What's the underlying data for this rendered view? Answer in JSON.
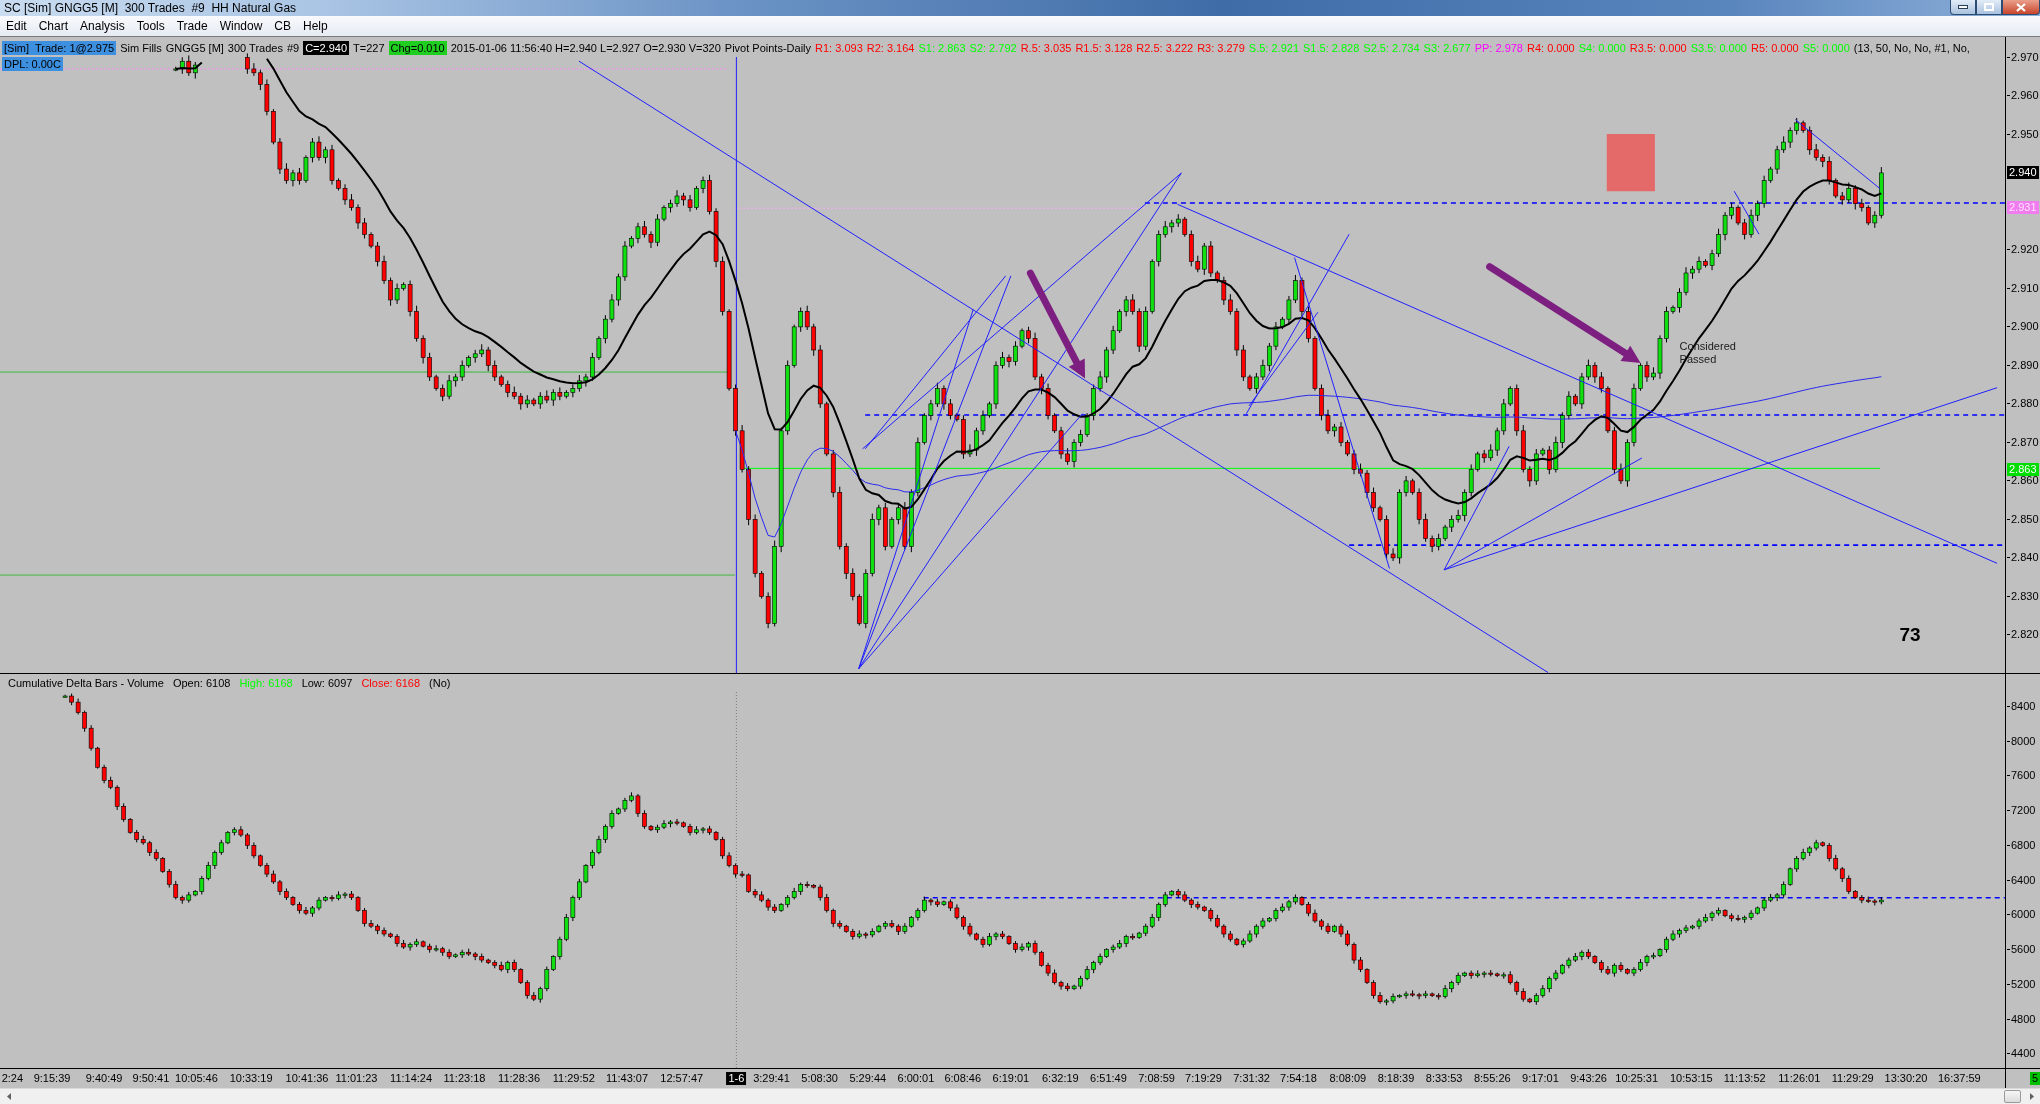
{
  "window": {
    "title": "SC [Sim] GNGG5 [M]  300 Trades  #9  HH Natural Gas"
  },
  "menu": [
    "Edit",
    "Chart",
    "Analysis",
    "Tools",
    "Trade",
    "Window",
    "CB",
    "Help"
  ],
  "price_panel": {
    "legend_rows": [
      [
        {
          "text": "[Sim]  Trade: 1@2.975",
          "kind": "highlight"
        },
        {
          "text": "Sim Fills",
          "kind": "plain"
        },
        {
          "text": "GNGG5 [M]",
          "kind": "plain"
        },
        {
          "text": "300 Trades",
          "kind": "plain"
        },
        {
          "text": "#9",
          "kind": "plain"
        },
        {
          "text": "C=2.940",
          "kind": "inverse"
        },
        {
          "text": "T=227",
          "kind": "plain"
        },
        {
          "text": "Chg=0.010",
          "kind": "change"
        },
        {
          "text": "2015-01-06 11:56:40 H=2.940 L=2.927 O=2.930 V=320",
          "kind": "plain"
        },
        {
          "text": "Pivot Points-Daily",
          "kind": "plain"
        },
        {
          "text": "R1: 3.093",
          "kind": "plain",
          "color": "#ff0000"
        },
        {
          "text": "R2: 3.164",
          "kind": "plain",
          "color": "#ff0000"
        },
        {
          "text": "S1: 2.863",
          "kind": "plain",
          "color": "#00ff00"
        },
        {
          "text": "S2: 2.792",
          "kind": "plain",
          "color": "#00ff00"
        },
        {
          "text": "R.5: 3.035",
          "kind": "plain",
          "color": "#ff0000"
        },
        {
          "text": "R1.5: 3.128",
          "kind": "plain",
          "color": "#ff0000"
        },
        {
          "text": "R2.5: 3.222",
          "kind": "plain",
          "color": "#ff0000"
        },
        {
          "text": "R3: 3.279",
          "kind": "plain",
          "color": "#ff0000"
        },
        {
          "text": "S.5: 2.921",
          "kind": "plain",
          "color": "#00ff00"
        },
        {
          "text": "S1.5: 2.828",
          "kind": "plain",
          "color": "#00ff00"
        },
        {
          "text": "S2.5: 2.734",
          "kind": "plain",
          "color": "#00ff00"
        },
        {
          "text": "S3: 2.677",
          "kind": "plain",
          "color": "#00ff00"
        },
        {
          "text": "PP: 2.978",
          "kind": "plain",
          "color": "#ff00ff"
        },
        {
          "text": "R4: 0.000",
          "kind": "plain",
          "color": "#ff0000"
        },
        {
          "text": "S4: 0.000",
          "kind": "plain",
          "color": "#00ff00"
        },
        {
          "text": "R3.5: 0.000",
          "kind": "plain",
          "color": "#ff0000"
        },
        {
          "text": "S3.5: 0.000",
          "kind": "plain",
          "color": "#00ff00"
        },
        {
          "text": "R5: 0.000",
          "kind": "plain",
          "color": "#ff0000"
        },
        {
          "text": "S5: 0.000",
          "kind": "plain",
          "color": "#00ff00"
        },
        {
          "text": "(13, 50, No, No, #1, No,",
          "kind": "plain"
        }
      ],
      [
        {
          "text": "DPL: 0.00C",
          "kind": "highlight"
        }
      ]
    ],
    "notes": [
      {
        "text": "Considered Passed",
        "kind": "note"
      },
      {
        "text": "73",
        "kind": "count"
      }
    ],
    "axis": [
      {
        "text": "2.970",
        "kind": "tick"
      },
      {
        "text": "2.960",
        "kind": "tick"
      },
      {
        "text": "2.950",
        "kind": "tick"
      },
      {
        "text": "2.940",
        "kind": "last"
      },
      {
        "text": "2.931",
        "kind": "pivot"
      },
      {
        "text": "2.920",
        "kind": "tick"
      },
      {
        "text": "2.910",
        "kind": "tick"
      },
      {
        "text": "2.900",
        "kind": "tick"
      },
      {
        "text": "2.890",
        "kind": "tick"
      },
      {
        "text": "2.880",
        "kind": "tick"
      },
      {
        "text": "2.870",
        "kind": "tick"
      },
      {
        "text": "2.860",
        "kind": "tick"
      },
      {
        "text": "2.850",
        "kind": "tick"
      },
      {
        "text": "2.840",
        "kind": "tick"
      },
      {
        "text": "2.830",
        "kind": "tick"
      },
      {
        "text": "2.820",
        "kind": "tick"
      }
    ],
    "axis_marker": {
      "text": "2.863",
      "kind": "level"
    }
  },
  "delta_panel": {
    "legend": [
      {
        "text": "Cumulative Delta Bars - Volume"
      },
      {
        "text": "Open: 6108"
      },
      {
        "text": "High: 6168",
        "color": "#00ff00"
      },
      {
        "text": "Low: 6097"
      },
      {
        "text": "Close: 6168",
        "color": "#ff0000"
      },
      {
        "text": "(No)"
      }
    ],
    "axis": [
      "8400",
      "8000",
      "7600",
      "7200",
      "6800",
      "6400",
      "6000",
      "5600",
      "5200",
      "4800",
      "4400"
    ]
  },
  "time_axis": {
    "labels": [
      {
        "text": "2:24",
        "kind": "time"
      },
      {
        "text": "9:15:39",
        "kind": "time"
      },
      {
        "text": "9:40:49",
        "kind": "time"
      },
      {
        "text": "9:50:41",
        "kind": "time"
      },
      {
        "text": "10:05:46",
        "kind": "time"
      },
      {
        "text": "10:33:19",
        "kind": "time"
      },
      {
        "text": "10:41:36",
        "kind": "time"
      },
      {
        "text": "11:01:23",
        "kind": "time"
      },
      {
        "text": "11:14:24",
        "kind": "time"
      },
      {
        "text": "11:23:18",
        "kind": "time"
      },
      {
        "text": "11:28:36",
        "kind": "time"
      },
      {
        "text": "11:29:52",
        "kind": "time"
      },
      {
        "text": "11:43:07",
        "kind": "time"
      },
      {
        "text": "12:57:47",
        "kind": "time"
      },
      {
        "text": "1-6",
        "kind": "date"
      },
      {
        "text": "3:29:41",
        "kind": "time"
      },
      {
        "text": "5:08:30",
        "kind": "time"
      },
      {
        "text": "5:29:44",
        "kind": "time"
      },
      {
        "text": "6:00:01",
        "kind": "time"
      },
      {
        "text": "6:08:46",
        "kind": "time"
      },
      {
        "text": "6:19:01",
        "kind": "time"
      },
      {
        "text": "6:32:19",
        "kind": "time"
      },
      {
        "text": "6:51:49",
        "kind": "time"
      },
      {
        "text": "7:08:59",
        "kind": "time"
      },
      {
        "text": "7:19:29",
        "kind": "time"
      },
      {
        "text": "7:31:32",
        "kind": "time"
      },
      {
        "text": "7:54:18",
        "kind": "time"
      },
      {
        "text": "8:08:09",
        "kind": "time"
      },
      {
        "text": "8:18:39",
        "kind": "time"
      },
      {
        "text": "8:33:53",
        "kind": "time"
      },
      {
        "text": "8:55:26",
        "kind": "time"
      },
      {
        "text": "9:17:01",
        "kind": "time"
      },
      {
        "text": "9:43:26",
        "kind": "time"
      },
      {
        "text": "10:25:31",
        "kind": "time"
      },
      {
        "text": "10:53:15",
        "kind": "time"
      },
      {
        "text": "11:13:52",
        "kind": "time"
      },
      {
        "text": "11:26:01",
        "kind": "time"
      },
      {
        "text": "11:29:29",
        "kind": "time"
      },
      {
        "text": "13:30:20",
        "kind": "time"
      },
      {
        "text": "16:37:59",
        "kind": "time"
      }
    ],
    "corner": "5"
  }
}
